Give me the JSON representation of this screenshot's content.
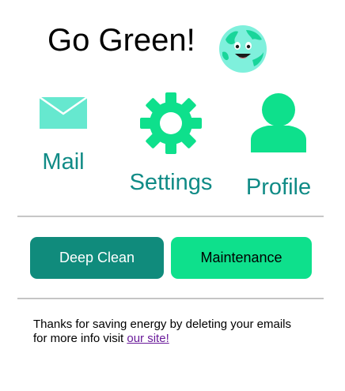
{
  "header": {
    "title": "Go Green!",
    "logo_icon": "earth-globe-face-icon"
  },
  "nav": {
    "mail": {
      "label": "Mail",
      "icon": "envelope-icon"
    },
    "settings": {
      "label": "Settings",
      "icon": "gear-icon"
    },
    "profile": {
      "label": "Profile",
      "icon": "user-silhouette-icon"
    }
  },
  "actions": {
    "deep_clean": "Deep Clean",
    "maintenance": "Maintenance"
  },
  "footer": {
    "text_line1": "Thanks for saving energy by deleting your emails",
    "text_line2_prefix": "for more info visit ",
    "link_text": "our site!"
  },
  "colors": {
    "accent_teal": "#108b86",
    "icon_green": "#0ee08c",
    "mail_icon": "#66e8cf",
    "deep_clean_bg": "#108b7c",
    "maintenance_bg": "#0ee08c",
    "link": "#6a1b9a"
  }
}
